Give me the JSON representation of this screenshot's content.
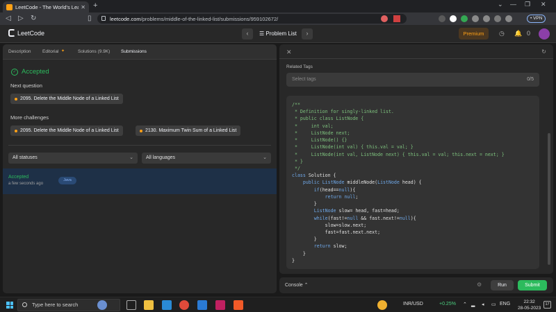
{
  "browser": {
    "tab_title": "LeetCode - The World's Leading O",
    "tab_close": "✕",
    "new_tab": "+",
    "url_host": "leetcode.com",
    "url_path": "/problems/middle-of-the-linked-list/submissions/959102672/",
    "vpn_label": "• VPN"
  },
  "header": {
    "logo_text": "LeetCode",
    "problem_list": "Problem List",
    "premium": "Premium",
    "streak": "0"
  },
  "left": {
    "tabs": [
      "Description",
      "Editorial",
      "Solutions (9.9K)",
      "Submissions"
    ],
    "status": "Accepted",
    "next_question_label": "Next question",
    "next_question": "2095. Delete the Middle Node of a Linked List",
    "more_challenges_label": "More challenges",
    "challenges": [
      "2095. Delete the Middle Node of a Linked List",
      "2130. Maximum Twin Sum of a Linked List"
    ],
    "filter_status": "All statuses",
    "filter_language": "All languages",
    "submission": {
      "status": "Accepted",
      "time": "a few seconds ago",
      "language": "Java"
    }
  },
  "right": {
    "related_tags_label": "Related Tags",
    "tags_placeholder": "Select tags",
    "tags_count": "0/5",
    "code_lines": [
      "/**",
      " * Definition for singly-linked list.",
      " * public class ListNode {",
      " *     int val;",
      " *     ListNode next;",
      " *     ListNode() {}",
      " *     ListNode(int val) { this.val = val; }",
      " *     ListNode(int val, ListNode next) { this.val = val; this.next = next; }",
      " * }",
      " */",
      "class Solution {",
      "    public ListNode middleNode(ListNode head) {",
      "        if(head==null){",
      "            return null;",
      "        }",
      "        ListNode slow= head, fast=head;",
      "        while(fast!=null && fast.next!=null){",
      "            slow=slow.next;",
      "            fast=fast.next.next;",
      "        }",
      "        return slow;",
      "    }",
      "}"
    ]
  },
  "console": {
    "label": "Console",
    "run": "Run",
    "submit": "Submit"
  },
  "taskbar": {
    "search_placeholder": "Type here to search",
    "stock": "INR/USD",
    "stock_change": "+0.25%",
    "lang": "ENG",
    "time": "22:32",
    "date": "28-05-2023",
    "notif_count": "17"
  },
  "colors": {
    "accent_green": "#2cbb5d",
    "accent_orange": "#ffa116",
    "selected_row": "#1e3047"
  }
}
